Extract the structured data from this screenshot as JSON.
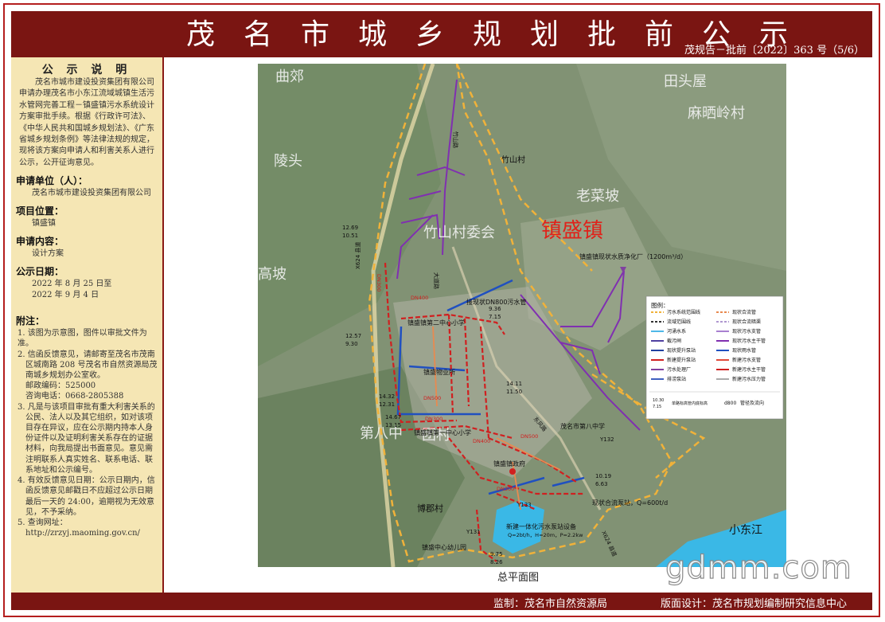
{
  "header": {
    "title": "茂名市城乡规划批前公示",
    "doc_number": "茂规告－批前〔2022〕363 号（5/6）"
  },
  "sidebar": {
    "notice_title": "公 示 说 明",
    "intro": "茂名市城市建设投资集团有限公司申请办理茂名市小东江流域城镇生活污水管网完善工程－镇盛镇污水系统设计方案审批手续。根据《行政许可法》、《中华人民共和国城乡规划法》、《广东省城乡规划条例》等法律法规的规定，现将该方案向申请人和利害关系人进行公示，公开征询意见。",
    "applicant_label": "申请单位（人）：",
    "applicant": "茂名市城市建设投资集团有限公司",
    "location_label": "项目位置：",
    "location": "镇盛镇",
    "content_label": "申请内容：",
    "content": "设计方案",
    "date_label": "公示日期：",
    "date_from": "2022 年 8 月 25 日至",
    "date_to": "2022 年 9 月 4 日",
    "notes_label": "附注：",
    "notes": [
      "1. 该图为示意图，图件以审批文件为准。",
      "2. 信函反馈意见，请邮寄至茂名市茂南区城南路 208 号茂名市自然资源局茂南城乡规划办公室收。",
      "邮政编码：525000",
      "咨询电话：0668-2805388",
      "3. 凡是与该项目审批有重大利害关系的公民、法人以及其它组织，如对该项目存在异议，应在公示期内持本人身份证件以及证明利害关系存在的证据材料，向我局提出书面意见。意见需注明联系人真实姓名、联系电话、联系地址和公示编号。",
      "4. 有效反馈意见日期：公示日期内，信函反馈意见邮戳日不应超过公示日期最后一天的 24:00，逾期视为无效意见，不予采纳。",
      "5. 查询网址：",
      "http://zrzyj.maoming.gov.cn/"
    ]
  },
  "map": {
    "caption": "总平面图",
    "town_label": "镇盛镇",
    "places": {
      "qujiao": "曲郊",
      "tiantouwu": "田头屋",
      "mashailing": "麻晒岭村",
      "lingsan": "陵头",
      "zhushan": "竹山村",
      "laocaipo": "老菜坡",
      "zhushan_faded": "竹山村委会",
      "gaopo": "高坡",
      "di8": "第八中",
      "bojun": "博郡村",
      "xiaodongjiang": "小东江",
      "tuanzhi": "团村"
    },
    "labels": {
      "plant": "镇盛镇现状水质净化厂（1200m³/d）",
      "connect": "接现状DN800污水管",
      "school2": "镇盛镇第二中心小学",
      "property": "镇盛物业所",
      "school1": "镇盛镇第一中心小学",
      "school8": "茂名市第八中学",
      "gov": "镇盛镇政府",
      "combined": "现状合流泵站，Q=600t/d",
      "pump_station": "新建一体化污水泵站设备",
      "pump_spec": "Q=2bt/h，H=20m，P=2.2kw",
      "kindergarten": "镇盛中心幼儿园",
      "road_zs": "竹山路",
      "road_dq": "大道路",
      "road_x624a": "X624 县道",
      "road_x624b": "X624 县道",
      "road_zhonghua": "东风路"
    },
    "elevations": [
      "12.69",
      "10.51",
      "12.57",
      "9.30",
      "14.32",
      "12.31",
      "14.67",
      "13.15",
      "14.11",
      "11.50",
      "9.36",
      "7.15",
      "10.19",
      "6.63",
      "9.75",
      "8.26"
    ],
    "pipe_labels": [
      "DN300",
      "DN400",
      "DN500",
      "DN300",
      "DN400",
      "DN300",
      "DN500",
      "Y132",
      "Y133",
      "Y131"
    ],
    "legend": {
      "title": "图例：",
      "left": [
        {
          "name": "污水系统范围线",
          "color": "#f0b23a"
        },
        {
          "name": "流域范围线",
          "color": "#333333"
        },
        {
          "name": "河涌水系",
          "color": "#4fb8e8"
        },
        {
          "name": "截污闸",
          "color": "#5040a0"
        },
        {
          "name": "现状提升泵站",
          "color": "#2040a0"
        },
        {
          "name": "新建提升泵站",
          "color": "#d02020"
        },
        {
          "name": "污水处理厂",
          "color": "#8040a0"
        },
        {
          "name": "排涝泵站",
          "color": "#4060c0"
        }
      ],
      "right": [
        {
          "name": "现状合流管",
          "color": "#e88a50"
        },
        {
          "name": "现状合流暗渠",
          "color": "#b098d0"
        },
        {
          "name": "现状污水支管",
          "color": "#a880d0"
        },
        {
          "name": "现状污水主干管",
          "color": "#8030b0"
        },
        {
          "name": "现状雨水管",
          "color": "#2050c0"
        },
        {
          "name": "新建污水支管",
          "color": "#e04a3a"
        },
        {
          "name": "新建污水主干管",
          "color": "#d02020"
        },
        {
          "name": "新建污水压力管",
          "color": "#aaaaaa"
        }
      ],
      "elev_sample_top": "10.30",
      "elev_sample_bottom": "7.15",
      "elev_note": "单路标高管内底标高",
      "dn_sample": "d800",
      "dn_note": "管径及流向"
    }
  },
  "watermark": "gdmm.com",
  "footer": {
    "supervisor": "监制：茂名市自然资源局",
    "designer": "版面设计：茂名市规划编制研究信息中心"
  }
}
